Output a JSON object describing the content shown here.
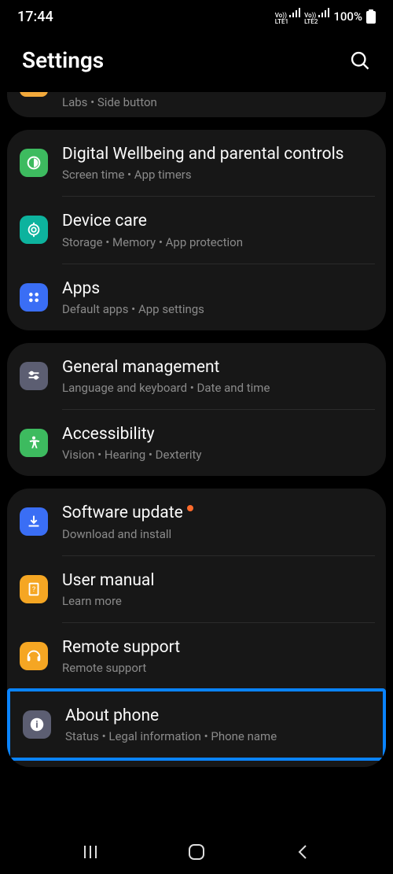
{
  "status": {
    "time": "17:44",
    "lte1": "Vo))\nLTE1",
    "lte2": "Vo))\nLTE2",
    "battery": "100%"
  },
  "header": {
    "title": "Settings"
  },
  "partial": {
    "sub": "Labs  •  Side button"
  },
  "group1": {
    "items": [
      {
        "title": "Digital Wellbeing and parental controls",
        "sub": "Screen time  •  App timers"
      },
      {
        "title": "Device care",
        "sub": "Storage  •  Memory  •  App protection"
      },
      {
        "title": "Apps",
        "sub": "Default apps  •  App settings"
      }
    ]
  },
  "group2": {
    "items": [
      {
        "title": "General management",
        "sub": "Language and keyboard  •  Date and time"
      },
      {
        "title": "Accessibility",
        "sub": "Vision  •  Hearing  •  Dexterity"
      }
    ]
  },
  "group3": {
    "items": [
      {
        "title": "Software update",
        "sub": "Download and install"
      },
      {
        "title": "User manual",
        "sub": "Learn more"
      },
      {
        "title": "Remote support",
        "sub": "Remote support"
      },
      {
        "title": "About phone",
        "sub": "Status  •  Legal information  •  Phone name"
      }
    ]
  }
}
